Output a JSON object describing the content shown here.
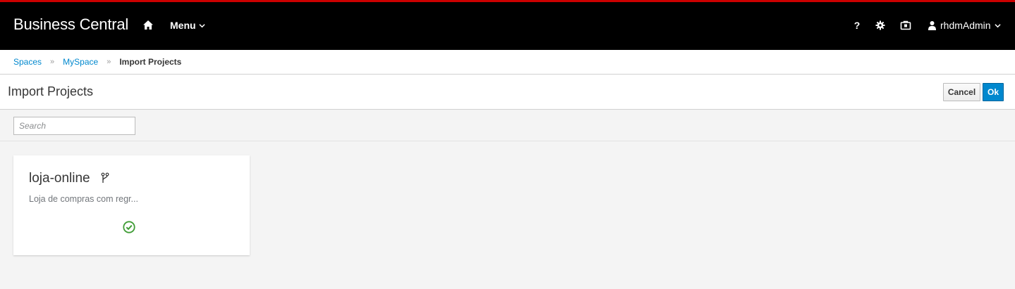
{
  "header": {
    "brand": "Business Central",
    "menu_label": "Menu",
    "help_label": "?",
    "user_name": "rhdmAdmin"
  },
  "breadcrumb": {
    "items": [
      "Spaces",
      "MySpace"
    ],
    "current": "Import Projects"
  },
  "page": {
    "title": "Import Projects",
    "cancel_label": "Cancel",
    "ok_label": "Ok"
  },
  "search": {
    "placeholder": "Search",
    "value": ""
  },
  "projects": [
    {
      "name": "loja-online",
      "description": "Loja de compras com regr...",
      "status_icon": "check-circle-icon",
      "status_color": "#3f9c35"
    }
  ],
  "colors": {
    "accent": "#0088ce",
    "topbar_stripe": "#cc0000",
    "topbar_bg": "#000000"
  }
}
